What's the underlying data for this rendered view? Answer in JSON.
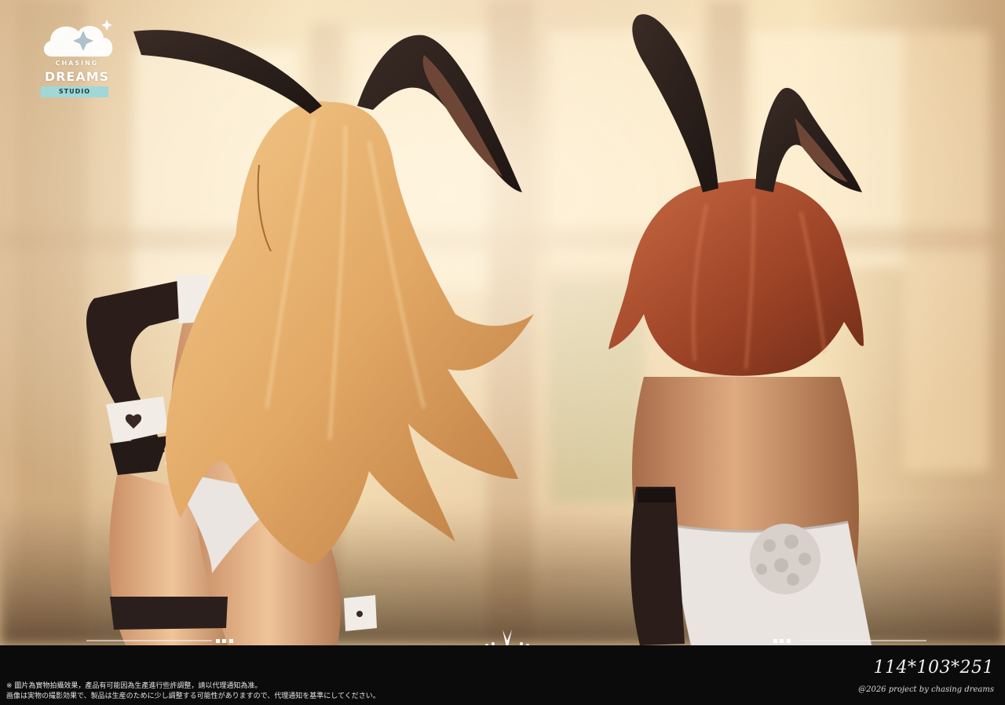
{
  "logo": {
    "line1": "CHASING",
    "line2": "DREAMS",
    "line3": "STUDIO"
  },
  "footer": {
    "notice_zh": "※ 圖片為實物拍攝效果，產品有可能因為生產進行些許調整，請以代理通知為准。",
    "notice_ja": "画像は実物の撮影効果で、製品は生産のために少し調整する可能性がありますので、代理通知を基準にしてください。",
    "dimensions": "114*103*251",
    "copyright": "@2026 project by chasing dreams"
  },
  "colors": {
    "background_light": "#f3d9a8",
    "window_glow": "#fff1d4",
    "blonde_hair": "#e7b373",
    "red_hair": "#a34a2c",
    "bunny_ears": "#2a201d",
    "suit_white": "#e9e4e0",
    "bar_bg": "#0b0b0c"
  }
}
